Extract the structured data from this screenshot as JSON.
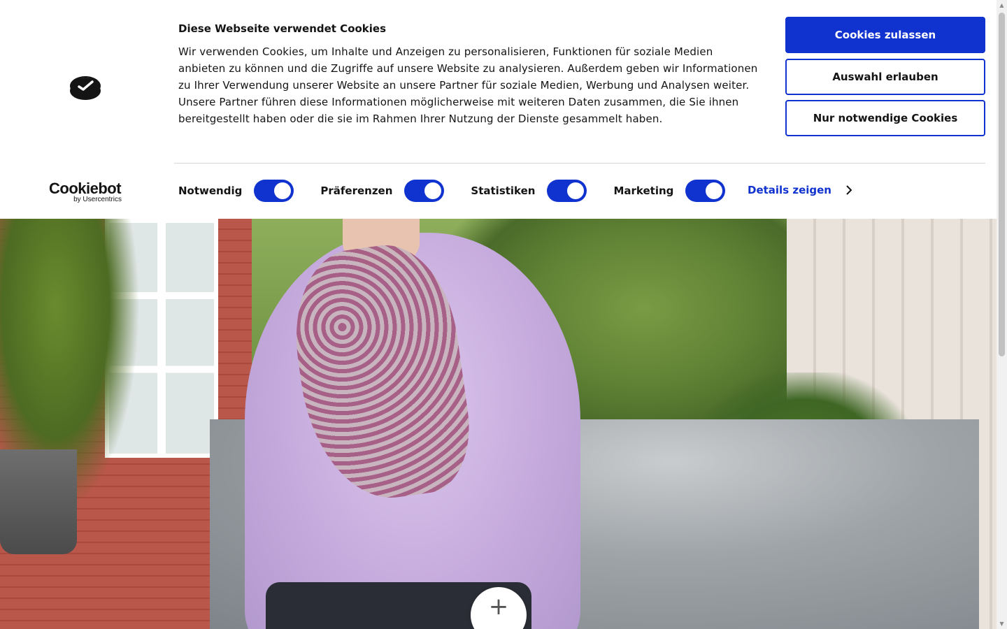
{
  "banner": {
    "title": "Diese Webseite verwendet Cookies",
    "description": "Wir verwenden Cookies, um Inhalte und Anzeigen zu personalisieren, Funktionen für soziale Medien anbieten zu können und die Zugriffe auf unsere Website zu analysieren. Außerdem geben wir Informationen zu Ihrer Verwendung unserer Website an unsere Partner für soziale Medien, Werbung und Analysen weiter. Unsere Partner führen diese Informationen möglicherweise mit weiteren Daten zusammen, die Sie ihnen bereitgestellt haben oder die sie im Rahmen Ihrer Nutzung der Dienste gesammelt haben.",
    "brand_name": "Cookiebot",
    "brand_sub": "by Usercentrics",
    "buttons": {
      "allow_all": "Cookies zulassen",
      "allow_selection": "Auswahl erlauben",
      "necessary_only": "Nur notwendige Cookies"
    },
    "toggles": [
      {
        "label": "Notwendig",
        "checked": true
      },
      {
        "label": "Präferenzen",
        "checked": true
      },
      {
        "label": "Statistiken",
        "checked": true
      },
      {
        "label": "Marketing",
        "checked": true
      }
    ],
    "details_link": "Details zeigen",
    "accent_color": "#1032cf"
  },
  "hero": {
    "plus_symbol": "+"
  },
  "icons": [
    "cookiebot-logo-icon",
    "chevron-right-icon",
    "plus-icon",
    "scroll-up-icon",
    "scroll-down-icon"
  ]
}
